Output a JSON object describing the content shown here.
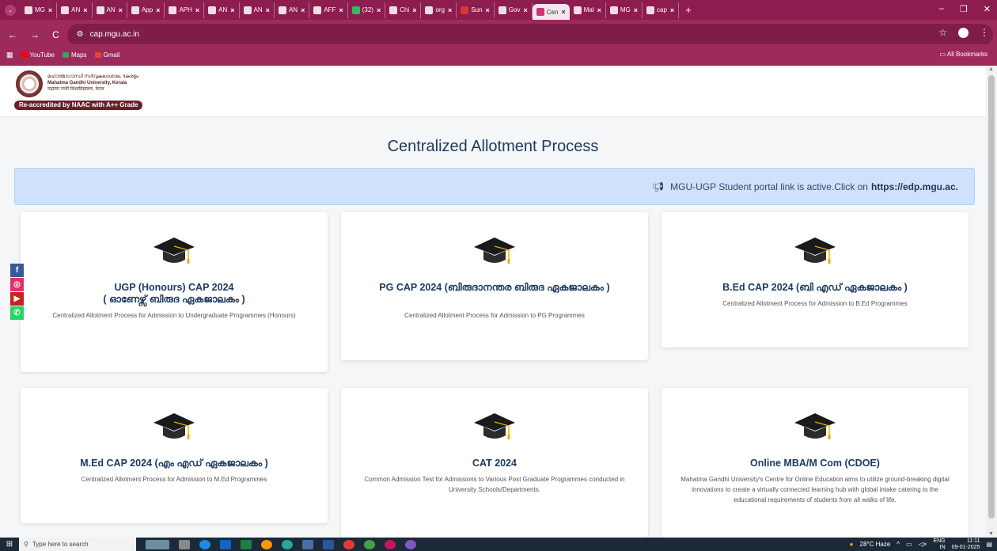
{
  "browser": {
    "tabs": [
      {
        "label": "MG",
        "color": "#ffffff"
      },
      {
        "label": "AN",
        "color": "#ffffff"
      },
      {
        "label": "AN",
        "color": "#ffffff"
      },
      {
        "label": "App",
        "color": "#ffffff"
      },
      {
        "label": "APH",
        "color": "#ffffff"
      },
      {
        "label": "AN",
        "color": "#ffffff"
      },
      {
        "label": "AN",
        "color": "#ffffff"
      },
      {
        "label": "AN",
        "color": "#ffffff"
      },
      {
        "label": "AFF",
        "color": "#ffffff"
      },
      {
        "label": "(32)",
        "color": "#25d366"
      },
      {
        "label": "Chi",
        "color": "#ffffff"
      },
      {
        "label": "org",
        "color": "#ffffff"
      },
      {
        "label": "Sun",
        "color": "#e53935"
      },
      {
        "label": "Gov",
        "color": "#ffffff"
      },
      {
        "label": "Cen",
        "color": "#c2185b",
        "active": true
      },
      {
        "label": "Mal",
        "color": "#ffffff"
      },
      {
        "label": "MG",
        "color": "#ffffff"
      },
      {
        "label": "cap",
        "color": "#ffffff"
      }
    ],
    "tab_close": "×",
    "new_tab": "+",
    "url": "cap.mgu.ac.in",
    "bookmarks": [
      {
        "label": "YouTube",
        "color": "#ff0000"
      },
      {
        "label": "Maps",
        "color": "#34a853"
      },
      {
        "label": "Gmail",
        "color": "#ea4335"
      }
    ],
    "all_bookmarks": "All Bookmarks",
    "theme_color": "#9e2a5b"
  },
  "header": {
    "university_ml": "മഹാത്മാഗാന്ധി സർവ്വകലാശാല, കേരളം",
    "university_en": "Mahatma Gandhi University, Kerala",
    "university_hi": "महात्मा गांधी विश्वविद्यालय, केरल",
    "accreditation": "Re-accredited by NAAC with A++ Grade"
  },
  "page": {
    "title": "Centralized Allotment Process",
    "notice_text": "MGU-UGP Student portal link is active.Click on",
    "notice_link": "https://edp.mgu.ac."
  },
  "cards": [
    {
      "title": "UGP (Honours) CAP 2024\n( ഓണേഴ്സ് ബിരുദ ഏകജാലകം )",
      "desc": "Centralized Allotment Process for Admission to Undergraduate Programmes (Honours)"
    },
    {
      "title": "PG CAP 2024 (ബിരുദാനന്തര ബിരുദ ഏകജാലകം )",
      "desc": "Centralized Allotment Process for Admission to PG Programmes"
    },
    {
      "title": "B.Ed CAP 2024 (ബി എഡ് ഏകജാലകം )",
      "desc": "Centralized Allotment Process for Admission to B.Ed Programmes"
    },
    {
      "title": "M.Ed CAP 2024 (എം എഡ് ഏകജാലകം )",
      "desc": "Centralized Allotment Process for Admission to M.Ed Programmes"
    },
    {
      "title": "CAT 2024",
      "desc": "Common Admission Test for Admissions to Various Post Graduate Programmes conducted in University Schools/Departments."
    },
    {
      "title": "Online MBA/M Com (CDOE)",
      "desc": "Mahatma Gandhi University's Centre for Online Education aims to utilize ground-breaking digital innovations to create a virtually connected learning hub with global intake catering to the educational requirements of students from all walks of life."
    }
  ],
  "social": [
    {
      "icon": "facebook-icon",
      "glyph": "f",
      "color": "#3b5998"
    },
    {
      "icon": "instagram-icon",
      "glyph": "◎",
      "color": "#e1306c"
    },
    {
      "icon": "youtube-icon",
      "glyph": "▶",
      "color": "#cd201f"
    },
    {
      "icon": "whatsapp-icon",
      "glyph": "✆",
      "color": "#25d366"
    }
  ],
  "taskbar": {
    "search_placeholder": "Type here to search",
    "weather": "28°C Haze",
    "lang": "ENG",
    "region": "IN",
    "time": "11:11",
    "date": "09-01-2025"
  }
}
